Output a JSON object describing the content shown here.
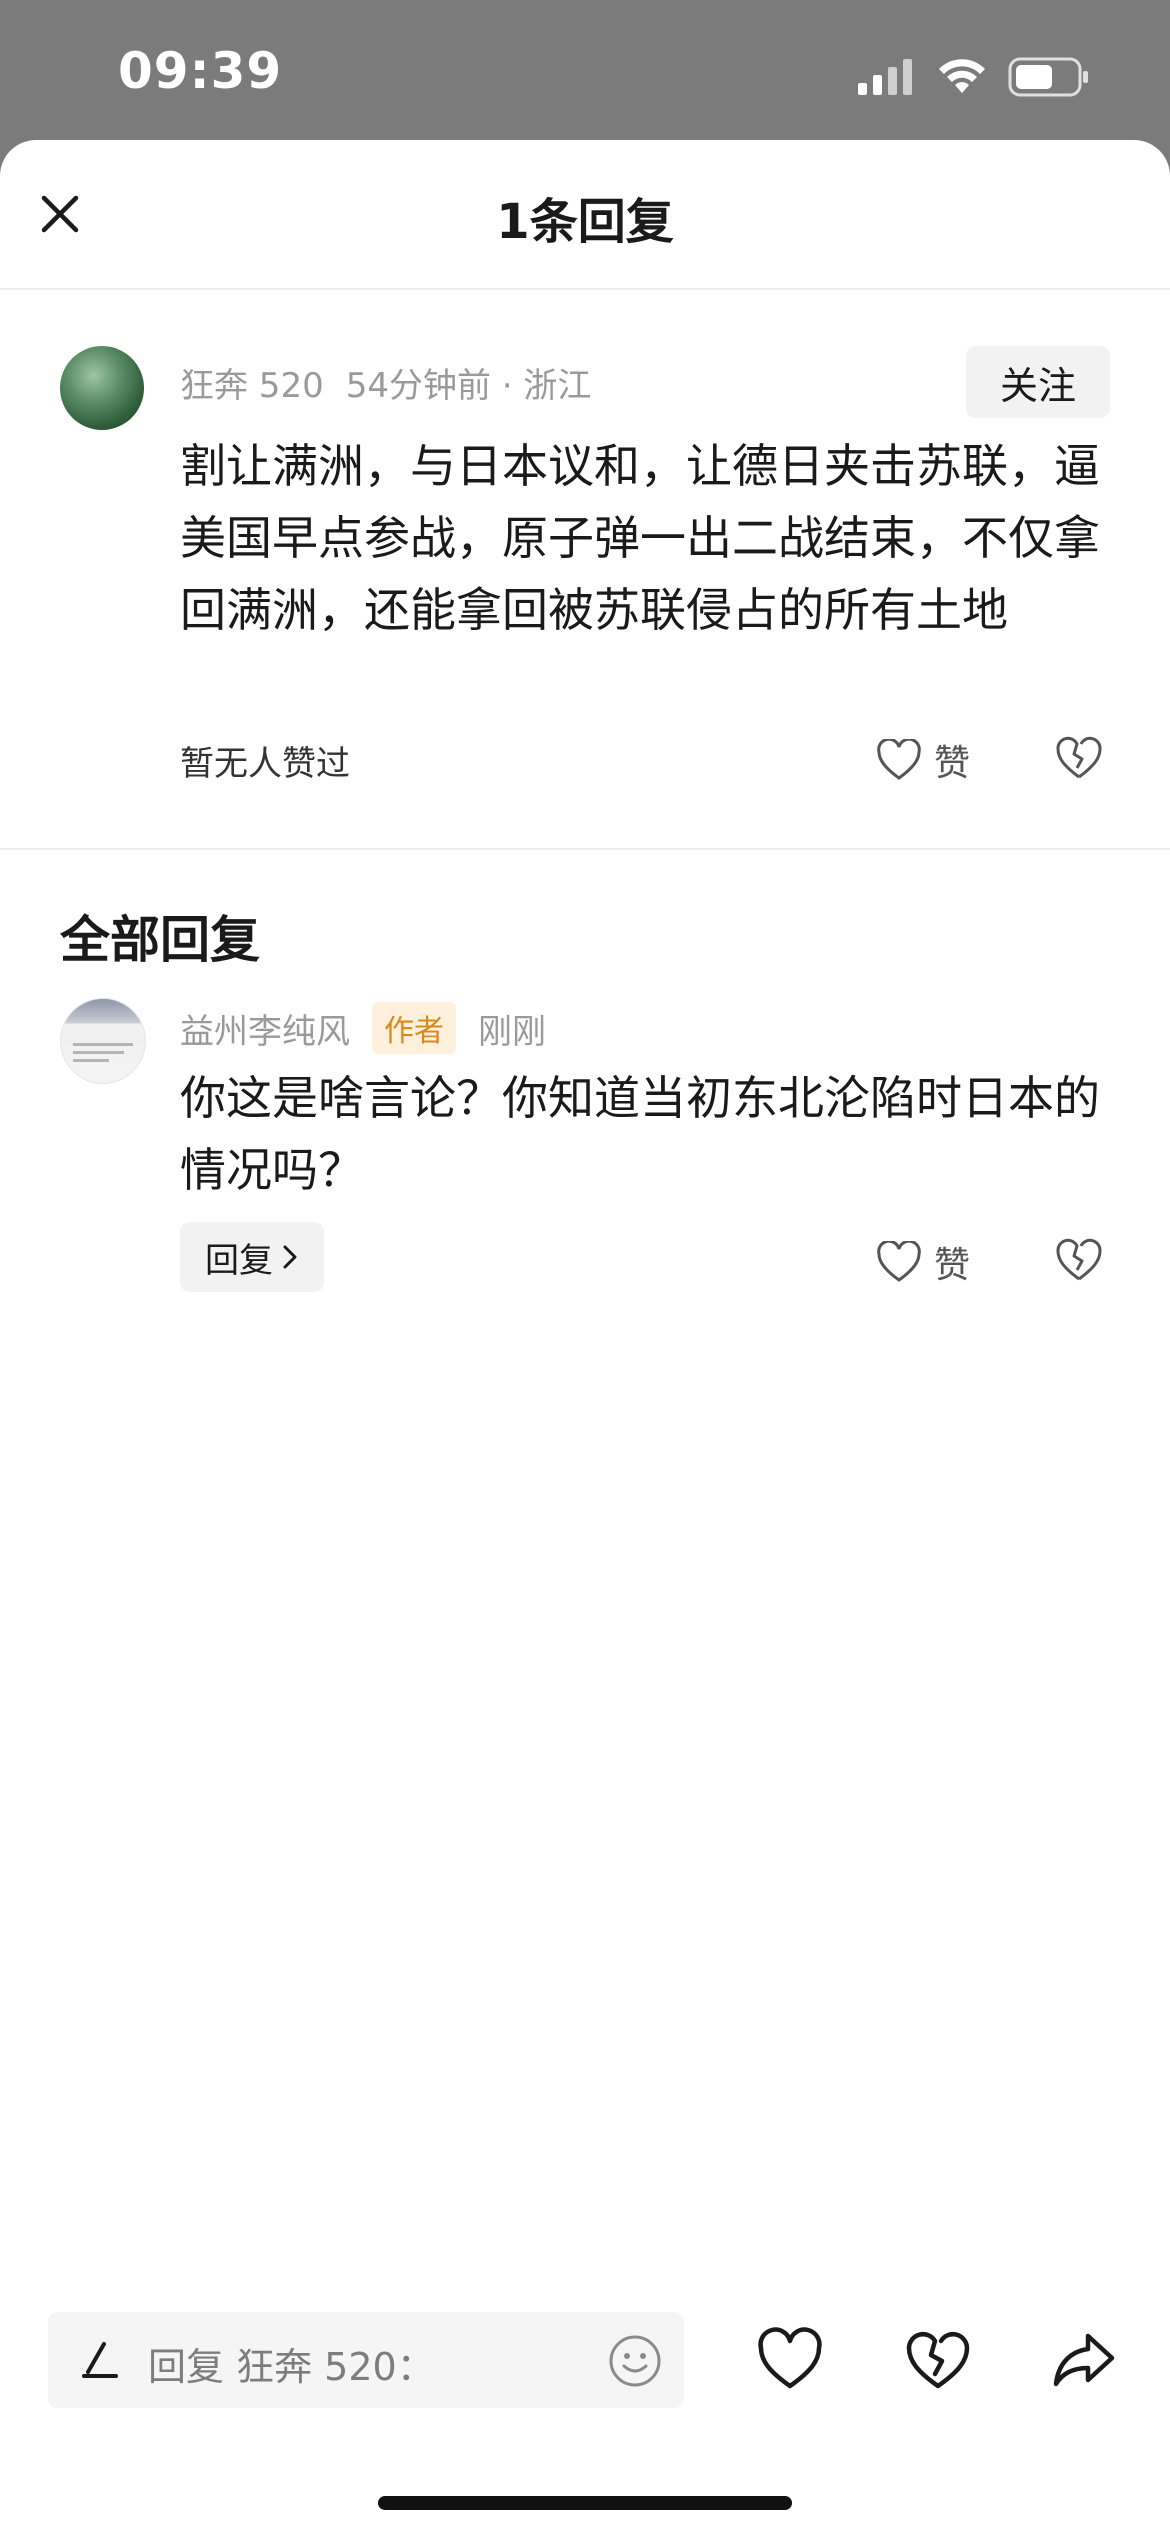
{
  "status_bar": {
    "time": "09:39",
    "icons": [
      "cellular-signal-icon",
      "wifi-icon",
      "battery-icon"
    ]
  },
  "header": {
    "title": "1条回复",
    "close_icon": "close-icon"
  },
  "main_comment": {
    "username": "狂奔 520",
    "time_ago": "54分钟前",
    "separator": "·",
    "location": "浙江",
    "follow_label": "关注",
    "body": "割让满洲，与日本议和，让德日夹击苏联，逼美国早点参战，原子弹一出二战结束，不仅拿回满洲，还能拿回被苏联侵占的所有土地",
    "likes_status": "暂无人赞过",
    "like_label": "赞"
  },
  "replies_section": {
    "title": "全部回复",
    "replies": [
      {
        "username": "益州李纯风",
        "badge": "作者",
        "time_ago": "刚刚",
        "body": "你这是啥言论？你知道当初东北沦陷时日本的情况吗？",
        "reply_label": "回复",
        "like_label": "赞"
      }
    ]
  },
  "bottom_bar": {
    "input_placeholder": "回复 狂奔 520：",
    "icons": [
      "pen-icon",
      "emoji-icon",
      "heart-icon",
      "broken-heart-icon",
      "share-icon"
    ]
  },
  "colors": {
    "background_dim": "#7b7b7b",
    "sheet": "#ffffff",
    "secondary_text": "#9a9a9a",
    "author_badge_bg": "#fdf0dc",
    "author_badge_text": "#d98a1c"
  }
}
